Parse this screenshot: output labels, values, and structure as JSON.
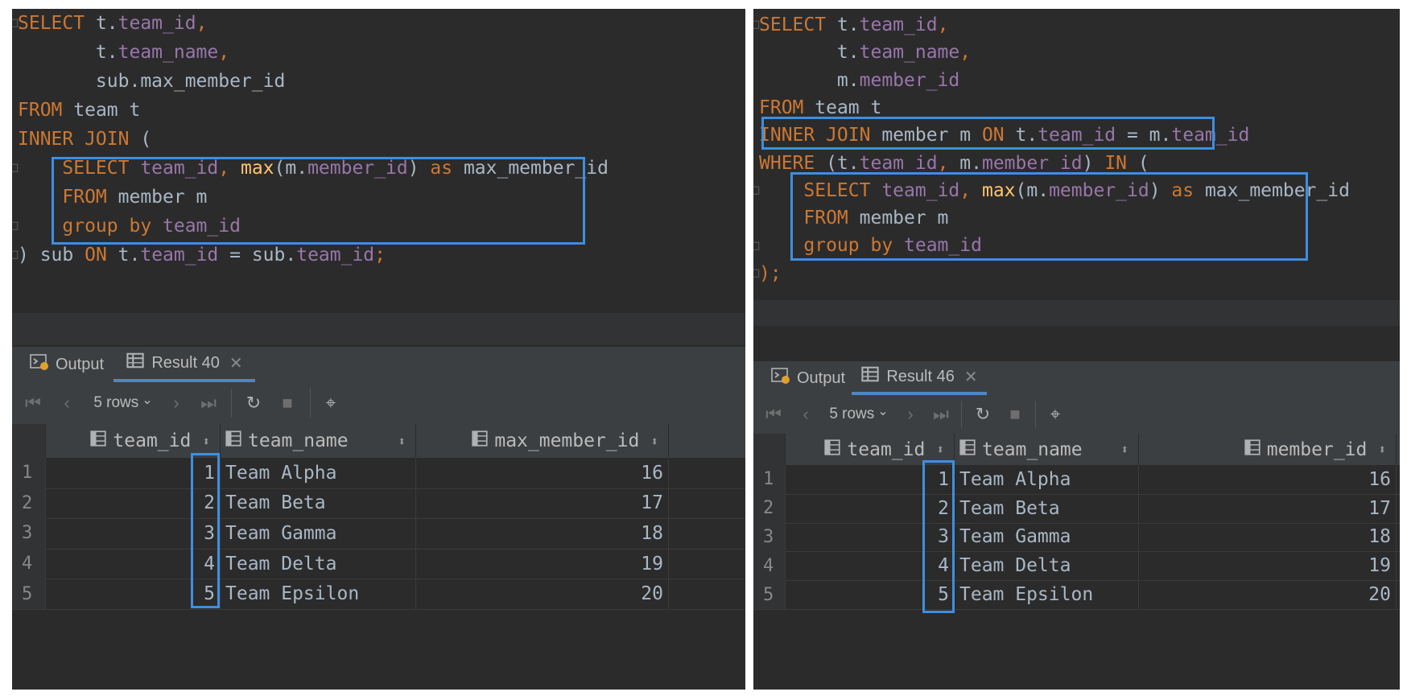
{
  "panels": [
    {
      "code": [
        [
          {
            "t": "SELECT ",
            "c": "kw"
          },
          {
            "t": "t.",
            "c": ""
          },
          {
            "t": "team_id",
            "c": "fld"
          },
          {
            "t": ",",
            "c": "kw"
          }
        ],
        [
          {
            "t": "       t.",
            "c": ""
          },
          {
            "t": "team_name",
            "c": "fld"
          },
          {
            "t": ",",
            "c": "kw"
          }
        ],
        [
          {
            "t": "       sub.max_member_id",
            "c": ""
          }
        ],
        [
          {
            "t": "FROM ",
            "c": "kw"
          },
          {
            "t": "team t",
            "c": ""
          }
        ],
        [
          {
            "t": "INNER JOIN ",
            "c": "kw"
          },
          {
            "t": "(",
            "c": ""
          }
        ],
        [
          {
            "t": "    SELECT ",
            "c": "kw"
          },
          {
            "t": "team_id",
            "c": "fld"
          },
          {
            "t": ", ",
            "c": "kw"
          },
          {
            "t": "max",
            "c": "fn"
          },
          {
            "t": "(m.",
            "c": ""
          },
          {
            "t": "member_id",
            "c": "fld"
          },
          {
            "t": ") ",
            "c": ""
          },
          {
            "t": "as ",
            "c": "kw"
          },
          {
            "t": "max_member_id",
            "c": ""
          }
        ],
        [
          {
            "t": "    FROM ",
            "c": "kw"
          },
          {
            "t": "member m",
            "c": ""
          }
        ],
        [
          {
            "t": "    group by ",
            "c": "kw"
          },
          {
            "t": "team_id",
            "c": "fld"
          }
        ],
        [
          {
            "t": ") sub ",
            "c": ""
          },
          {
            "t": "ON ",
            "c": "kw"
          },
          {
            "t": "t.",
            "c": ""
          },
          {
            "t": "team_id",
            "c": "fld"
          },
          {
            "t": " = sub.",
            "c": ""
          },
          {
            "t": "team_id",
            "c": "fld"
          },
          {
            "t": ";",
            "c": "kw"
          }
        ]
      ],
      "tabs": {
        "output": "Output",
        "result": "Result 40"
      },
      "rows_label": "5 rows",
      "columns": [
        "team_id",
        "team_name",
        "max_member_id"
      ],
      "rows": [
        [
          "1",
          "1",
          "Team Alpha",
          "16"
        ],
        [
          "2",
          "2",
          "Team Beta",
          "17"
        ],
        [
          "3",
          "3",
          "Team Gamma",
          "18"
        ],
        [
          "4",
          "4",
          "Team Delta",
          "19"
        ],
        [
          "5",
          "5",
          "Team Epsilon",
          "20"
        ]
      ]
    },
    {
      "code": [
        [
          {
            "t": "SELECT ",
            "c": "kw"
          },
          {
            "t": "t.",
            "c": ""
          },
          {
            "t": "team_id",
            "c": "fld"
          },
          {
            "t": ",",
            "c": "kw"
          }
        ],
        [
          {
            "t": "       t.",
            "c": ""
          },
          {
            "t": "team_name",
            "c": "fld"
          },
          {
            "t": ",",
            "c": "kw"
          }
        ],
        [
          {
            "t": "       m.",
            "c": ""
          },
          {
            "t": "member_id",
            "c": "fld"
          }
        ],
        [
          {
            "t": "FROM ",
            "c": "kw"
          },
          {
            "t": "team t",
            "c": ""
          }
        ],
        [
          {
            "t": "INNER JOIN ",
            "c": "kw"
          },
          {
            "t": "member m ",
            "c": ""
          },
          {
            "t": "ON ",
            "c": "kw"
          },
          {
            "t": "t.",
            "c": ""
          },
          {
            "t": "team_id",
            "c": "fld"
          },
          {
            "t": " = m.",
            "c": ""
          },
          {
            "t": "team_id",
            "c": "fld"
          }
        ],
        [
          {
            "t": "WHERE ",
            "c": "kw"
          },
          {
            "t": "(t.",
            "c": ""
          },
          {
            "t": "team_id",
            "c": "fld"
          },
          {
            "t": ", ",
            "c": "kw"
          },
          {
            "t": "m.",
            "c": ""
          },
          {
            "t": "member_id",
            "c": "fld"
          },
          {
            "t": ") ",
            "c": ""
          },
          {
            "t": "IN ",
            "c": "kw"
          },
          {
            "t": "(",
            "c": ""
          }
        ],
        [
          {
            "t": "    SELECT ",
            "c": "kw"
          },
          {
            "t": "team_id",
            "c": "fld"
          },
          {
            "t": ", ",
            "c": "kw"
          },
          {
            "t": "max",
            "c": "fn"
          },
          {
            "t": "(m.",
            "c": ""
          },
          {
            "t": "member_id",
            "c": "fld"
          },
          {
            "t": ") ",
            "c": ""
          },
          {
            "t": "as ",
            "c": "kw"
          },
          {
            "t": "max_member_id",
            "c": ""
          }
        ],
        [
          {
            "t": "    FROM ",
            "c": "kw"
          },
          {
            "t": "member m",
            "c": ""
          }
        ],
        [
          {
            "t": "    group by ",
            "c": "kw"
          },
          {
            "t": "team_id",
            "c": "fld"
          }
        ],
        [
          {
            "t": ");",
            "c": "kw"
          }
        ]
      ],
      "tabs": {
        "output": "Output",
        "result": "Result 46"
      },
      "rows_label": "5 rows",
      "columns": [
        "team_id",
        "team_name",
        "member_id"
      ],
      "rows": [
        [
          "1",
          "1",
          "Team Alpha",
          "16"
        ],
        [
          "2",
          "2",
          "Team Beta",
          "17"
        ],
        [
          "3",
          "3",
          "Team Gamma",
          "18"
        ],
        [
          "4",
          "4",
          "Team Delta",
          "19"
        ],
        [
          "5",
          "5",
          "Team Epsilon",
          "20"
        ]
      ]
    }
  ],
  "colors": {
    "keyword": "#cc7832",
    "field": "#9876aa",
    "function": "#ffc66d",
    "highlight": "#3d8fe0",
    "background": "#2b2b2b"
  }
}
